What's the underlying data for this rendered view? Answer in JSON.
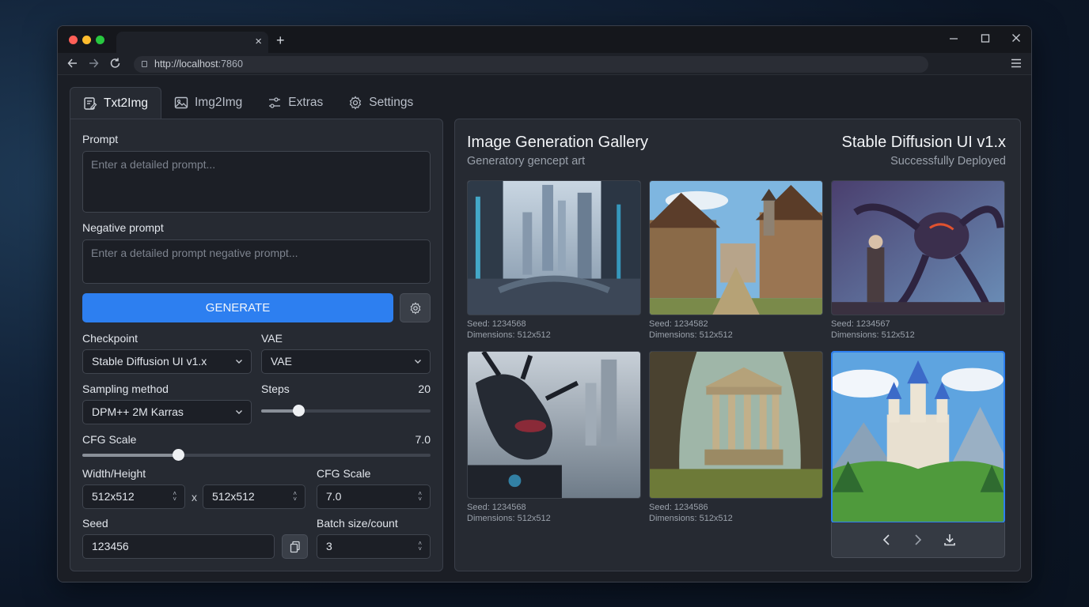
{
  "browser": {
    "url_host": "http://localhost",
    "url_port": ":7860",
    "tab_close": "×",
    "new_tab": "+"
  },
  "app_tabs": [
    {
      "label": "Txt2Img",
      "icon": "edit-note-icon"
    },
    {
      "label": "Img2Img",
      "icon": "image-icon"
    },
    {
      "label": "Extras",
      "icon": "sliders-icon"
    },
    {
      "label": "Settings",
      "icon": "gear-icon"
    }
  ],
  "form": {
    "prompt_label": "Prompt",
    "prompt_placeholder": "Enter a detailed prompt...",
    "negative_label": "Negative prompt",
    "negative_placeholder": "Enter a detailed prompt negative prompt...",
    "generate_label": "GENERATE",
    "checkpoint_label": "Checkpoint",
    "checkpoint_value": "Stable Diffusion UI v1.x",
    "vae_label": "VAE",
    "vae_value": "VAE",
    "sampling_label": "Sampling method",
    "sampling_value": "DPM++ 2M Karras",
    "steps_label": "Steps",
    "steps_value": "20",
    "steps_fraction": 0.22,
    "cfg_label": "CFG Scale",
    "cfg_value": "7.0",
    "cfg_fraction": 0.276,
    "wh_label": "Width/Height",
    "width_value": "512x512",
    "x_sep": "x",
    "height_value": "512x512",
    "cfg2_label": "CFG Scale",
    "cfg2_value": "7.0",
    "seed_label": "Seed",
    "seed_value": "123456",
    "batch_label": "Batch size/count",
    "batch_value": "3"
  },
  "gallery": {
    "title": "Image Generation Gallery",
    "subtitle": "Generatory gencept art",
    "model_title": "Stable Diffusion UI v1.x",
    "status": "Successfully Deployed",
    "images": [
      {
        "seed": "Seed: 1234568",
        "dims": "Dimensions: 512x512",
        "subject": "futuristic city"
      },
      {
        "seed": "Seed: 1234582",
        "dims": "Dimensions: 512x512",
        "subject": "medieval village"
      },
      {
        "seed": "Seed: 1234567",
        "dims": "Dimensions: 512x512",
        "subject": "warrior and alien creature"
      },
      {
        "seed": "Seed: 1234568",
        "dims": "Dimensions: 512x512",
        "subject": "dark dragon"
      },
      {
        "seed": "Seed: 1234586",
        "dims": "Dimensions: 512x512",
        "subject": "ancient temple ruins"
      },
      {
        "subject": "fairytale castle"
      }
    ]
  },
  "colors": {
    "accent": "#2d7ff0",
    "panel": "#262a32",
    "background": "#1b1e25"
  }
}
